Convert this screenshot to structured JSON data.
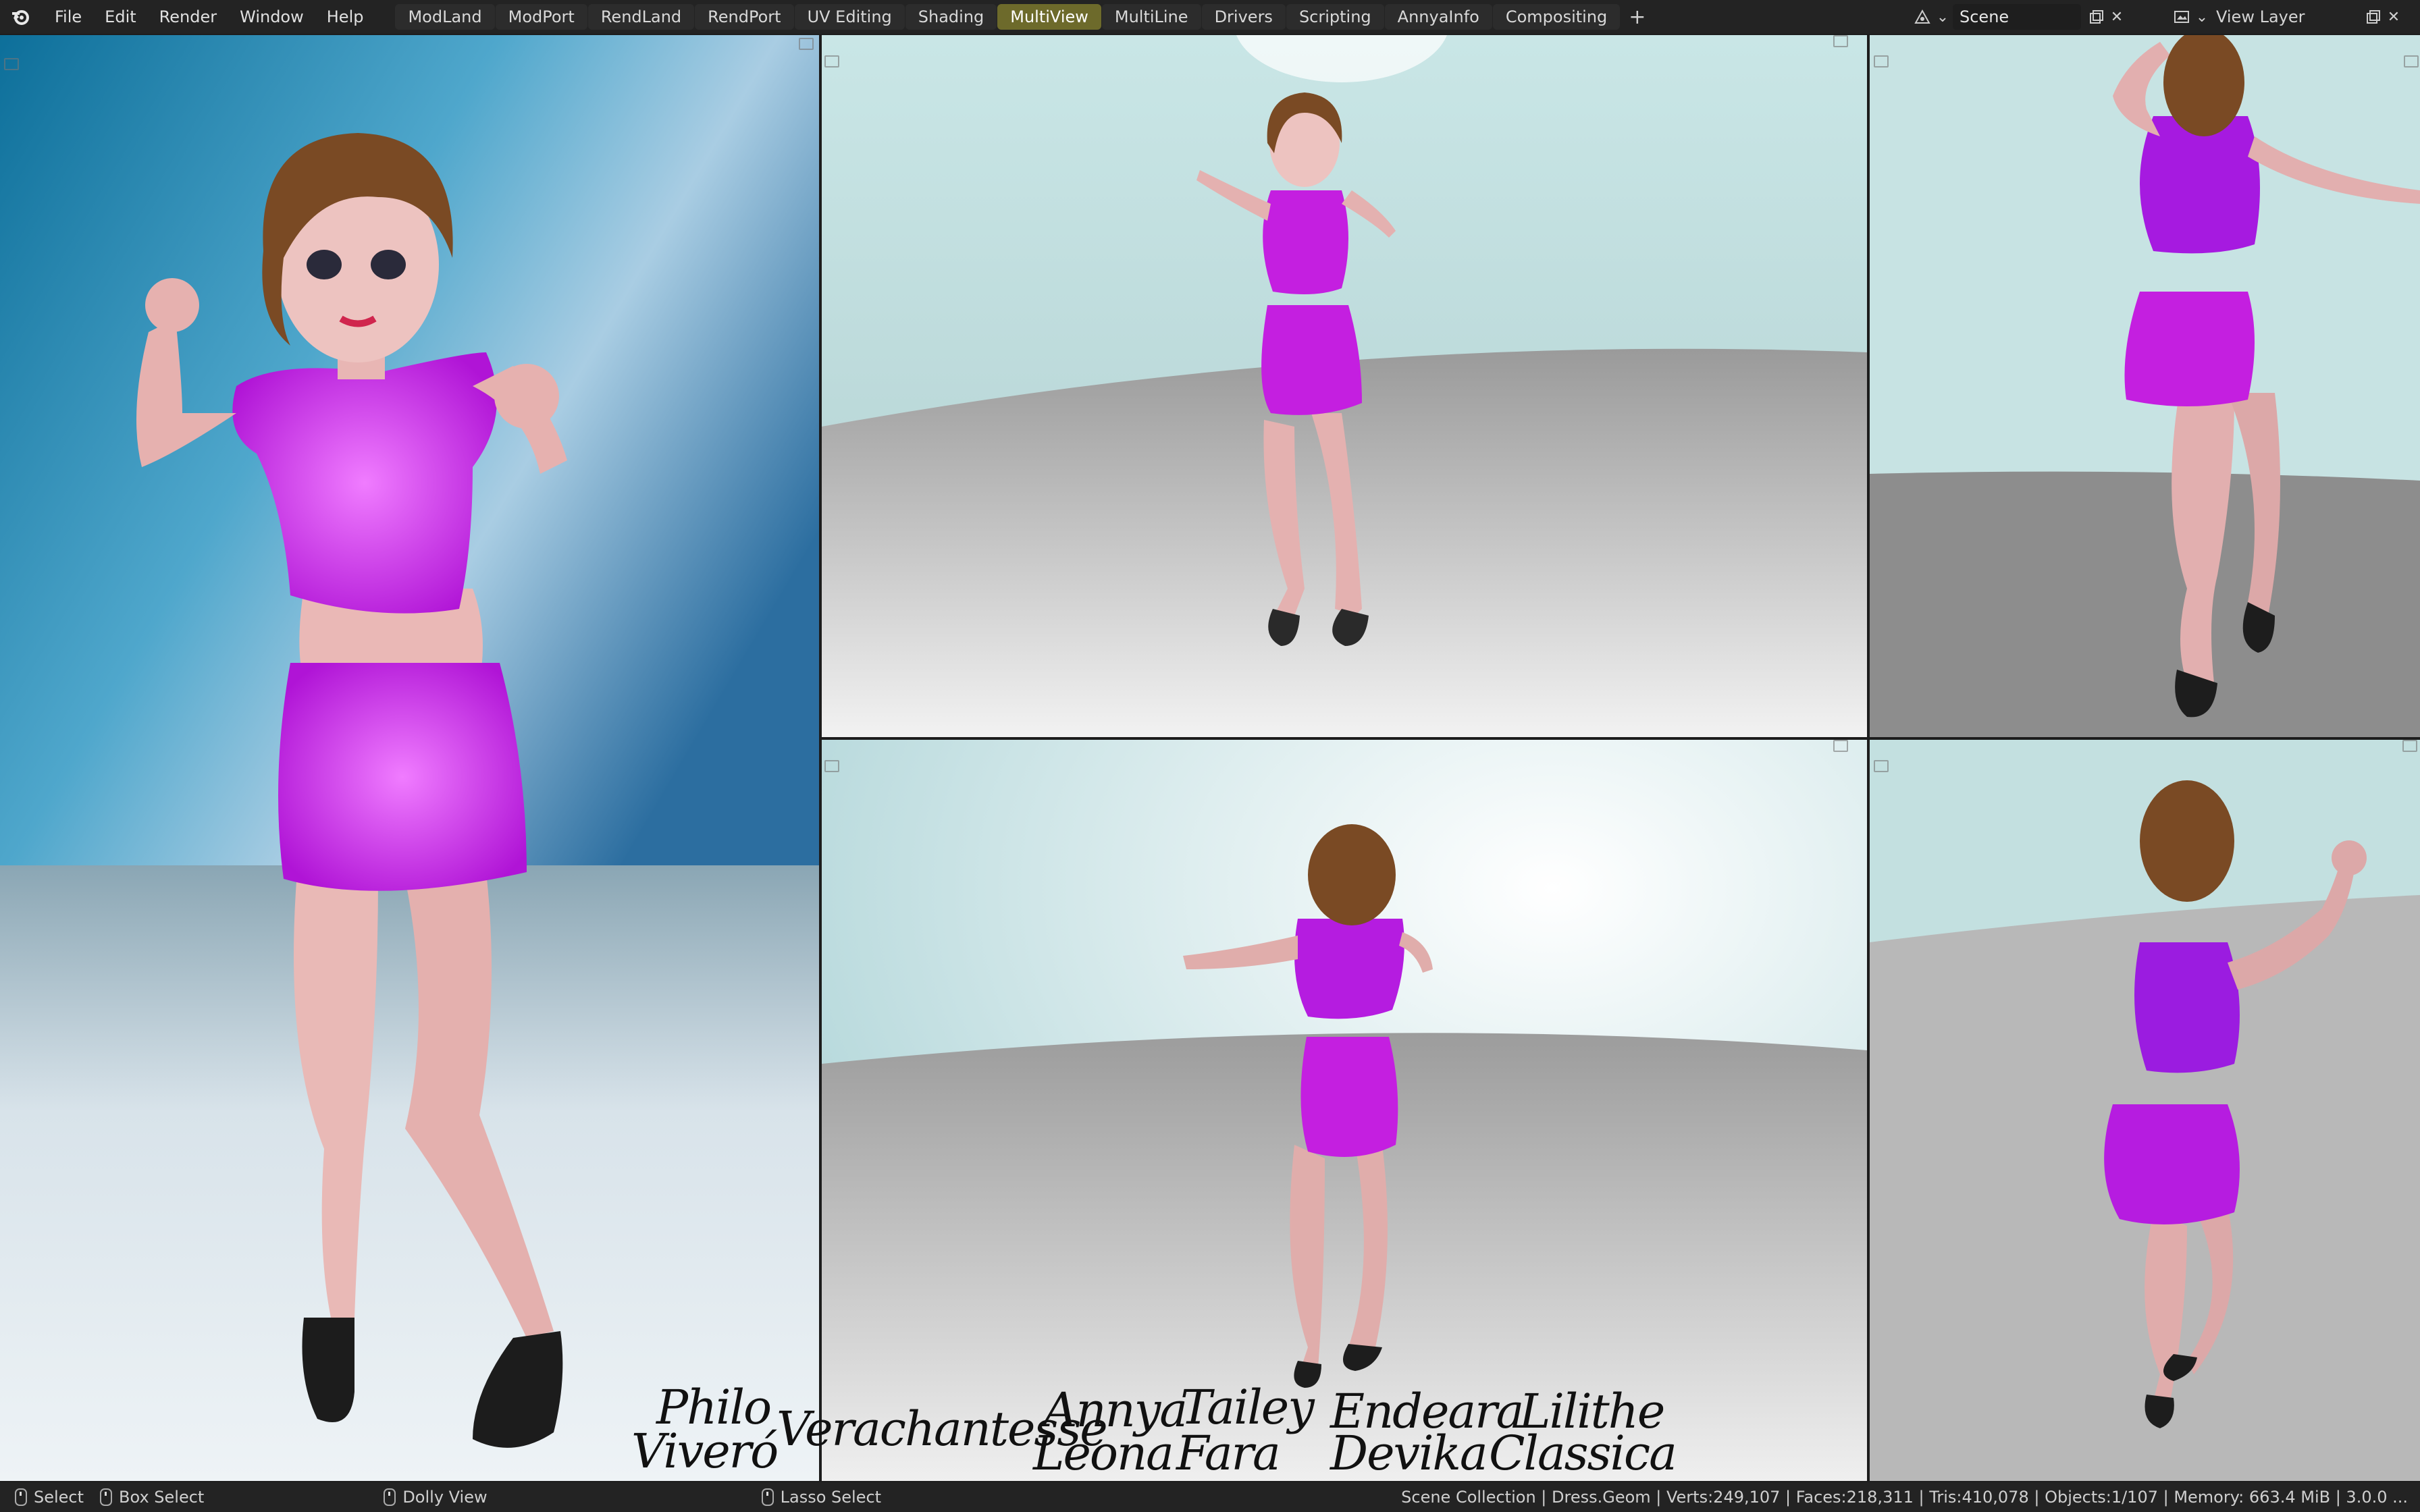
{
  "menu": {
    "file": "File",
    "edit": "Edit",
    "render": "Render",
    "window": "Window",
    "help": "Help"
  },
  "workspaces": [
    {
      "label": "ModLand",
      "active": false
    },
    {
      "label": "ModPort",
      "active": false
    },
    {
      "label": "RendLand",
      "active": false
    },
    {
      "label": "RendPort",
      "active": false
    },
    {
      "label": "UV Editing",
      "active": false
    },
    {
      "label": "Shading",
      "active": false
    },
    {
      "label": "MultiView",
      "active": true
    },
    {
      "label": "MultiLine",
      "active": false
    },
    {
      "label": "Drivers",
      "active": false
    },
    {
      "label": "Scripting",
      "active": false
    },
    {
      "label": "AnnyaInfo",
      "active": false
    },
    {
      "label": "Compositing",
      "active": false
    }
  ],
  "add_workspace": "+",
  "scene": {
    "name": "Scene"
  },
  "view_layer": {
    "name": "View Layer"
  },
  "names_overlay": {
    "philo": "Philo",
    "viverro": "Viveró",
    "verachantesse": "Verachantesse",
    "annya": "Annya",
    "leona": "Leona",
    "tailey": "Tailey",
    "fara": "Fara",
    "endeara": "Endeara",
    "devika": "Devika",
    "lilithe": "Lilithe",
    "classica": "Classica"
  },
  "status": {
    "select": "Select",
    "box_select": "Box Select",
    "dolly_view": "Dolly View",
    "lasso_select": "Lasso Select",
    "stats": "Scene Collection | Dress.Geom | Verts:249,107 | Faces:218,311 | Tris:410,078 | Objects:1/107 | Memory: 663.4 MiB | 3.0.0 ..."
  },
  "colors": {
    "accent_tab": "#6d6a2b",
    "dress": "#c41fe0",
    "skin": "#e8b7b6",
    "hair": "#7a4a24"
  }
}
